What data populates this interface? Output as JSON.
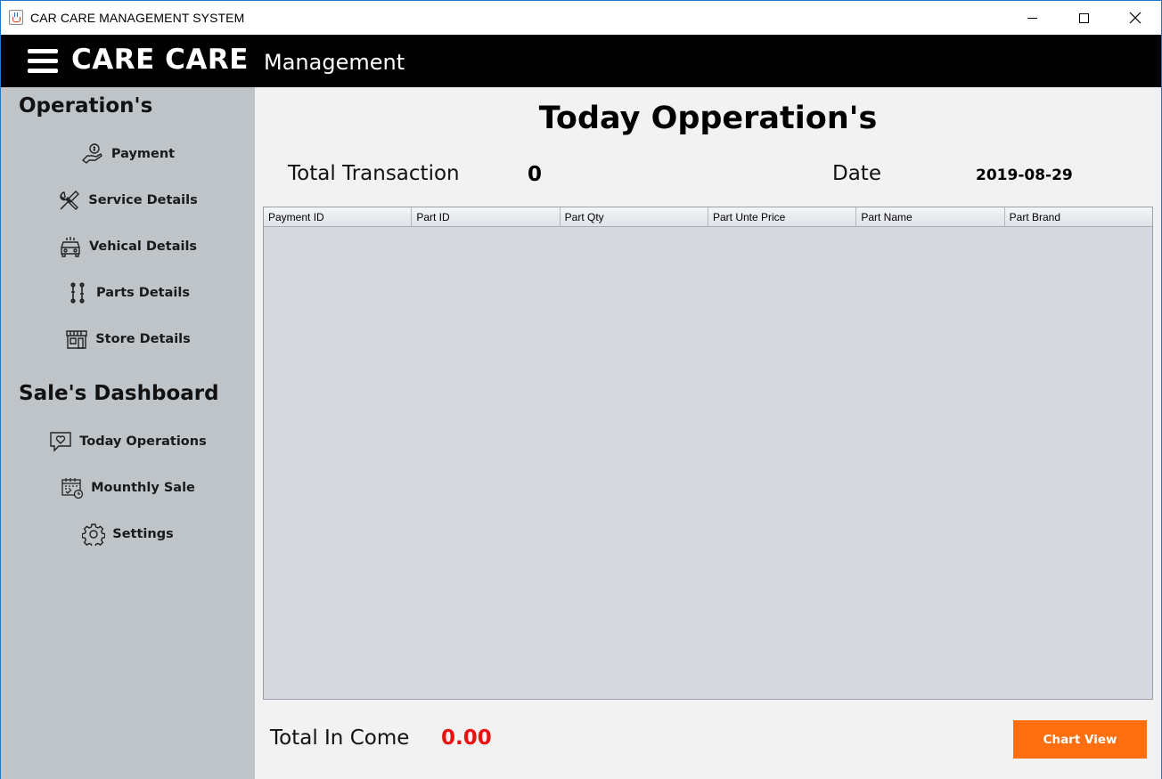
{
  "window": {
    "title": "CAR CARE MANAGEMENT SYSTEM"
  },
  "header": {
    "brand": "CARE CARE",
    "subtitle": "Management"
  },
  "sidebar": {
    "operations_title": "Operation's",
    "operations": [
      {
        "label": "Payment",
        "icon": "payment-hand-icon"
      },
      {
        "label": "Service Details",
        "icon": "wrench-screwdriver-icon"
      },
      {
        "label": "Vehical Details",
        "icon": "car-icon"
      },
      {
        "label": "Parts Details",
        "icon": "parts-icon"
      },
      {
        "label": "Store Details",
        "icon": "store-icon"
      }
    ],
    "dashboard_title": "Sale's Dashboard",
    "dashboard": [
      {
        "label": "Today Operations",
        "icon": "heart-chat-icon"
      },
      {
        "label": "Mounthly Sale",
        "icon": "calendar-check-icon"
      },
      {
        "label": "Settings",
        "icon": "gear-icon"
      }
    ]
  },
  "main": {
    "title": "Today Opperation's",
    "total_transaction_label": "Total Transaction",
    "total_transaction_value": "0",
    "date_label": "Date",
    "date_value": "2019-08-29",
    "table": {
      "columns": [
        "Payment ID",
        "Part ID",
        "Part Qty",
        "Part Unte Price",
        "Part Name",
        "Part Brand"
      ],
      "rows": []
    },
    "total_income_label": "Total In Come",
    "total_income_value": "0.00",
    "chart_button": "Chart View"
  },
  "colors": {
    "header_bg": "#000000",
    "sidebar_bg": "#bfc4c9",
    "main_bg": "#f2f2f2",
    "table_bg": "#d6d9e0",
    "income_value": "#e81010",
    "chart_button_bg": "#ff6f0f"
  }
}
